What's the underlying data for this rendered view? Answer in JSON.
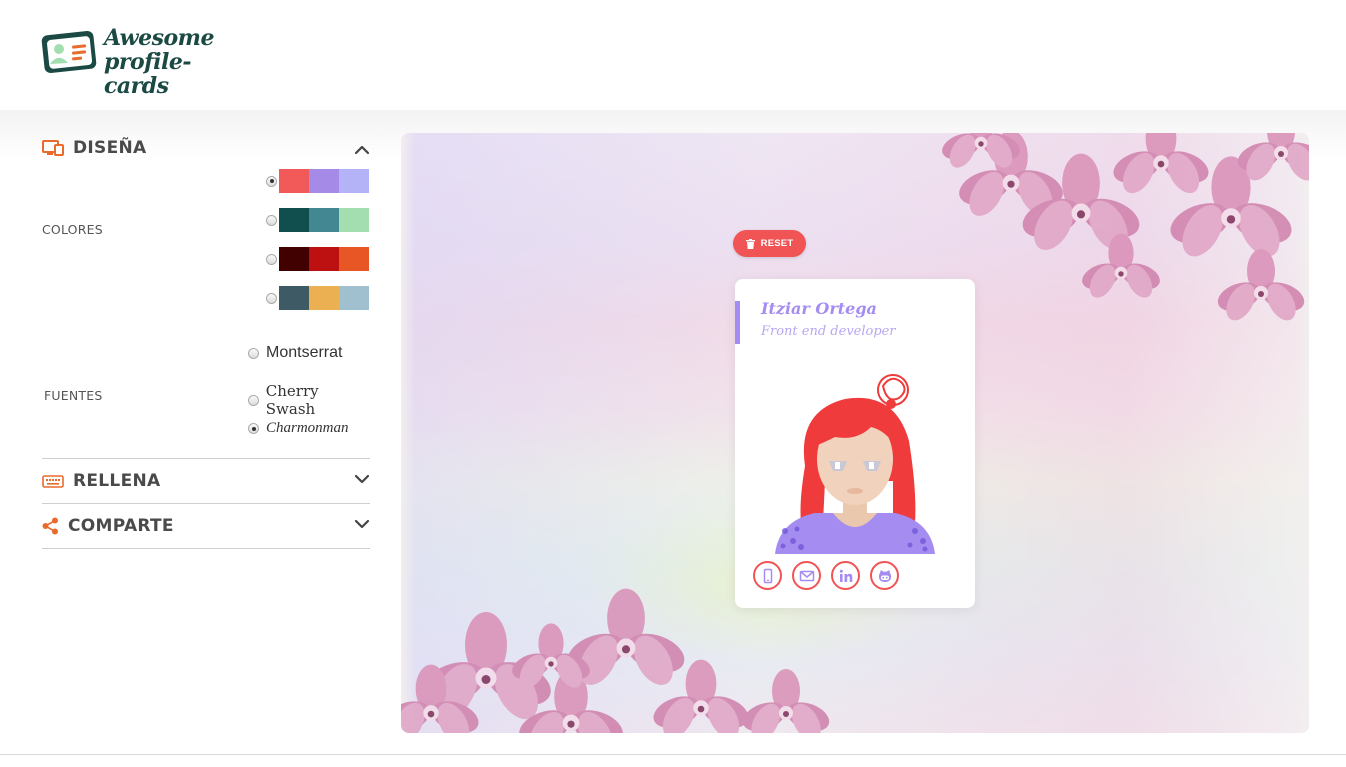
{
  "brand": {
    "line1": "Awesome",
    "line2": "profile-cards"
  },
  "sidebar": {
    "design": {
      "title": "DISEÑA",
      "icon": "design-icon",
      "colors_label": "COLORES",
      "palettes": [
        {
          "selected": true,
          "colors": [
            "#f25a5a",
            "#a68ae8",
            "#b5b3f7"
          ]
        },
        {
          "selected": false,
          "colors": [
            "#114e4e",
            "#438792",
            "#a2deaf"
          ]
        },
        {
          "selected": false,
          "colors": [
            "#420101",
            "#bd1010",
            "#e95626"
          ]
        },
        {
          "selected": false,
          "colors": [
            "#3e5b65",
            "#eab052",
            "#a0c0cf"
          ]
        }
      ],
      "fonts_label": "FUENTES",
      "fonts": [
        {
          "label": "Montserrat",
          "selected": false
        },
        {
          "label": "Cherry Swash",
          "selected": false
        },
        {
          "label": "Charmonman",
          "selected": true
        }
      ]
    },
    "fill": {
      "title": "RELLENA",
      "icon": "keyboard-icon"
    },
    "share": {
      "title": "COMPARTE",
      "icon": "share-icon"
    }
  },
  "preview": {
    "reset_label": "RESET",
    "card": {
      "name": "Itziar Ortega",
      "job": "Front end developer",
      "socials": [
        "mobile-icon",
        "email-icon",
        "linkedin-icon",
        "github-icon"
      ]
    }
  },
  "colors": {
    "accent": "#e96b2c",
    "card_primary": "#a58cf0",
    "card_secondary": "#f15454"
  }
}
